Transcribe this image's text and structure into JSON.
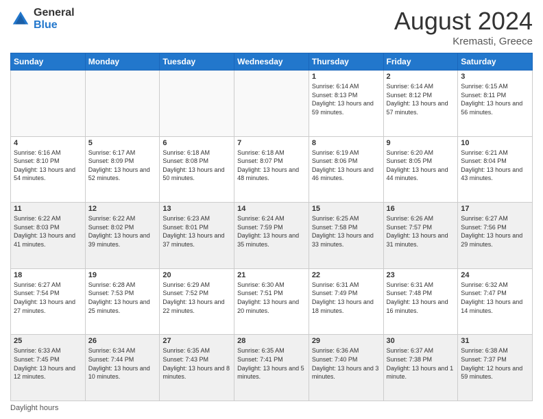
{
  "header": {
    "logo_general": "General",
    "logo_blue": "Blue",
    "month_title": "August 2024",
    "location": "Kremasti, Greece"
  },
  "footer": {
    "note": "Daylight hours"
  },
  "days_of_week": [
    "Sunday",
    "Monday",
    "Tuesday",
    "Wednesday",
    "Thursday",
    "Friday",
    "Saturday"
  ],
  "weeks": [
    [
      {
        "day": "",
        "empty": true
      },
      {
        "day": "",
        "empty": true
      },
      {
        "day": "",
        "empty": true
      },
      {
        "day": "",
        "empty": true
      },
      {
        "day": "1",
        "sunrise": "6:14 AM",
        "sunset": "8:13 PM",
        "daylight": "13 hours and 59 minutes."
      },
      {
        "day": "2",
        "sunrise": "6:14 AM",
        "sunset": "8:12 PM",
        "daylight": "13 hours and 57 minutes."
      },
      {
        "day": "3",
        "sunrise": "6:15 AM",
        "sunset": "8:11 PM",
        "daylight": "13 hours and 56 minutes."
      }
    ],
    [
      {
        "day": "4",
        "sunrise": "6:16 AM",
        "sunset": "8:10 PM",
        "daylight": "13 hours and 54 minutes."
      },
      {
        "day": "5",
        "sunrise": "6:17 AM",
        "sunset": "8:09 PM",
        "daylight": "13 hours and 52 minutes."
      },
      {
        "day": "6",
        "sunrise": "6:18 AM",
        "sunset": "8:08 PM",
        "daylight": "13 hours and 50 minutes."
      },
      {
        "day": "7",
        "sunrise": "6:18 AM",
        "sunset": "8:07 PM",
        "daylight": "13 hours and 48 minutes."
      },
      {
        "day": "8",
        "sunrise": "6:19 AM",
        "sunset": "8:06 PM",
        "daylight": "13 hours and 46 minutes."
      },
      {
        "day": "9",
        "sunrise": "6:20 AM",
        "sunset": "8:05 PM",
        "daylight": "13 hours and 44 minutes."
      },
      {
        "day": "10",
        "sunrise": "6:21 AM",
        "sunset": "8:04 PM",
        "daylight": "13 hours and 43 minutes."
      }
    ],
    [
      {
        "day": "11",
        "sunrise": "6:22 AM",
        "sunset": "8:03 PM",
        "daylight": "13 hours and 41 minutes."
      },
      {
        "day": "12",
        "sunrise": "6:22 AM",
        "sunset": "8:02 PM",
        "daylight": "13 hours and 39 minutes."
      },
      {
        "day": "13",
        "sunrise": "6:23 AM",
        "sunset": "8:01 PM",
        "daylight": "13 hours and 37 minutes."
      },
      {
        "day": "14",
        "sunrise": "6:24 AM",
        "sunset": "7:59 PM",
        "daylight": "13 hours and 35 minutes."
      },
      {
        "day": "15",
        "sunrise": "6:25 AM",
        "sunset": "7:58 PM",
        "daylight": "13 hours and 33 minutes."
      },
      {
        "day": "16",
        "sunrise": "6:26 AM",
        "sunset": "7:57 PM",
        "daylight": "13 hours and 31 minutes."
      },
      {
        "day": "17",
        "sunrise": "6:27 AM",
        "sunset": "7:56 PM",
        "daylight": "13 hours and 29 minutes."
      }
    ],
    [
      {
        "day": "18",
        "sunrise": "6:27 AM",
        "sunset": "7:54 PM",
        "daylight": "13 hours and 27 minutes."
      },
      {
        "day": "19",
        "sunrise": "6:28 AM",
        "sunset": "7:53 PM",
        "daylight": "13 hours and 25 minutes."
      },
      {
        "day": "20",
        "sunrise": "6:29 AM",
        "sunset": "7:52 PM",
        "daylight": "13 hours and 22 minutes."
      },
      {
        "day": "21",
        "sunrise": "6:30 AM",
        "sunset": "7:51 PM",
        "daylight": "13 hours and 20 minutes."
      },
      {
        "day": "22",
        "sunrise": "6:31 AM",
        "sunset": "7:49 PM",
        "daylight": "13 hours and 18 minutes."
      },
      {
        "day": "23",
        "sunrise": "6:31 AM",
        "sunset": "7:48 PM",
        "daylight": "13 hours and 16 minutes."
      },
      {
        "day": "24",
        "sunrise": "6:32 AM",
        "sunset": "7:47 PM",
        "daylight": "13 hours and 14 minutes."
      }
    ],
    [
      {
        "day": "25",
        "sunrise": "6:33 AM",
        "sunset": "7:45 PM",
        "daylight": "13 hours and 12 minutes."
      },
      {
        "day": "26",
        "sunrise": "6:34 AM",
        "sunset": "7:44 PM",
        "daylight": "13 hours and 10 minutes."
      },
      {
        "day": "27",
        "sunrise": "6:35 AM",
        "sunset": "7:43 PM",
        "daylight": "13 hours and 8 minutes."
      },
      {
        "day": "28",
        "sunrise": "6:35 AM",
        "sunset": "7:41 PM",
        "daylight": "13 hours and 5 minutes."
      },
      {
        "day": "29",
        "sunrise": "6:36 AM",
        "sunset": "7:40 PM",
        "daylight": "13 hours and 3 minutes."
      },
      {
        "day": "30",
        "sunrise": "6:37 AM",
        "sunset": "7:38 PM",
        "daylight": "13 hours and 1 minute."
      },
      {
        "day": "31",
        "sunrise": "6:38 AM",
        "sunset": "7:37 PM",
        "daylight": "12 hours and 59 minutes."
      }
    ]
  ]
}
